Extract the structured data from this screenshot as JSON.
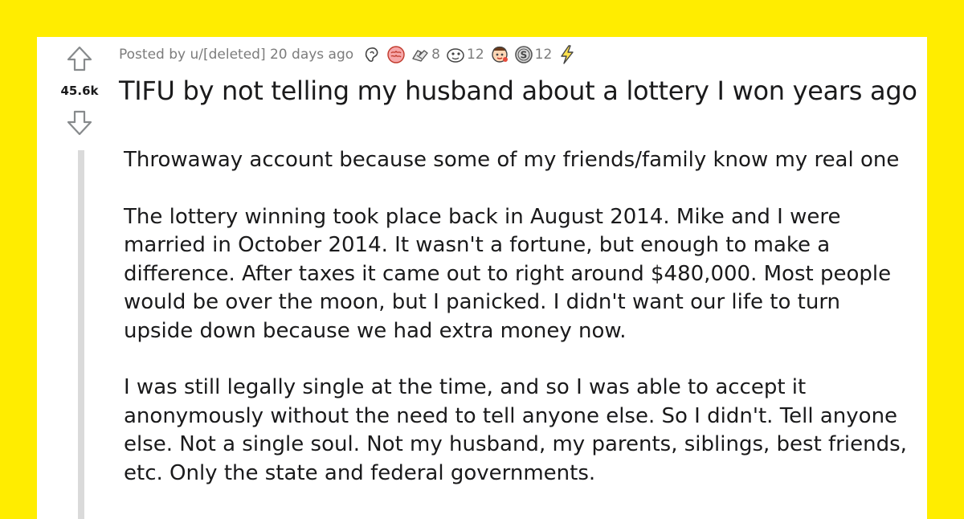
{
  "post": {
    "meta": "Posted by u/[deleted] 20 days ago",
    "score": "45.6k",
    "title": "TIFU by not telling my husband about a lottery I won years ago",
    "awards": [
      {
        "icon": "ear-award-icon",
        "count": ""
      },
      {
        "icon": "brain-award-icon",
        "count": ""
      },
      {
        "icon": "hands-award-icon",
        "count": "8"
      },
      {
        "icon": "face-award-icon",
        "count": "12"
      },
      {
        "icon": "wholesome-award-icon",
        "count": ""
      },
      {
        "icon": "silver-coin-award-icon",
        "count": "12"
      },
      {
        "icon": "lightning-award-icon",
        "count": ""
      }
    ],
    "paragraphs": [
      "Throwaway account because some of my friends/family know my real one",
      "The lottery winning took place back in August 2014. Mike and I were married in October 2014. It wasn't a fortune, but enough to make a difference. After taxes it came out to right around $480,000. Most people would be over the moon, but I panicked. I didn't want our life to turn upside down because we had extra money now.",
      "I was still legally single at the time, and so I was able to accept it anonymously without the need to tell anyone else. So I didn't. Tell anyone else. Not a single soul. Not my husband, my parents, siblings, best friends, etc. Only the state and federal governments."
    ]
  },
  "colors": {
    "background": "#FFED00",
    "card": "#ffffff",
    "text": "#1a1a1b",
    "meta": "#7c7c7c",
    "thread_line": "#dadada"
  }
}
